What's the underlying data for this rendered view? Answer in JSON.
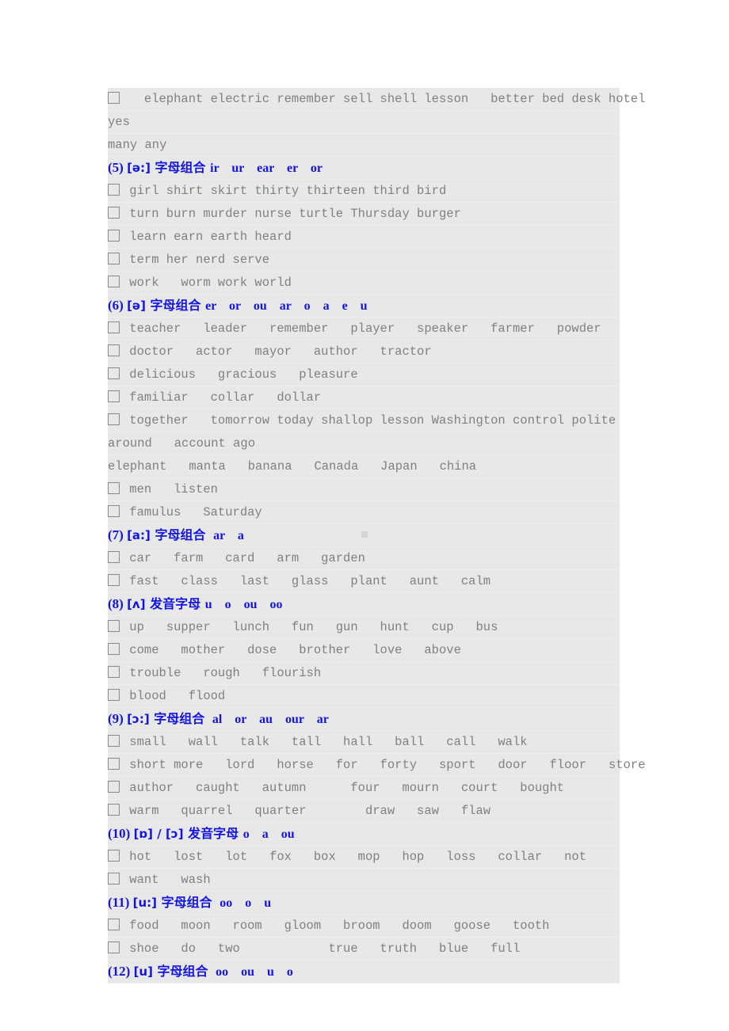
{
  "document": {
    "background_color": "#e8e8e8",
    "text_color": "#808080",
    "heading_color": "#1414e0",
    "checkbox_icon": "empty-checkbox"
  },
  "lines": [
    {
      "id": "l1",
      "type": "words",
      "checkbox": true,
      "text": "   elephant electric remember sell shell lesson   better bed desk hotel"
    },
    {
      "id": "l2",
      "type": "cont",
      "checkbox": false,
      "text": "yes"
    },
    {
      "id": "l3",
      "type": "cont",
      "checkbox": false,
      "text": "many any"
    },
    {
      "id": "h5",
      "type": "heading",
      "num": "(5)",
      "ipa": "[ə:]",
      "hz": "字母组合",
      "combos": "ir    ur    ear    er    or"
    },
    {
      "id": "l4",
      "type": "words",
      "checkbox": true,
      "text": " girl shirt skirt thirty thirteen third bird"
    },
    {
      "id": "l5",
      "type": "words",
      "checkbox": true,
      "text": " turn burn murder nurse turtle Thursday burger"
    },
    {
      "id": "l6",
      "type": "words",
      "checkbox": true,
      "text": " learn earn earth heard"
    },
    {
      "id": "l7",
      "type": "words",
      "checkbox": true,
      "text": " term her nerd serve"
    },
    {
      "id": "l8",
      "type": "words",
      "checkbox": true,
      "text": " work   worm work world"
    },
    {
      "id": "h6",
      "type": "heading",
      "num": "(6)",
      "ipa": "[ə]",
      "hz": "字母组合",
      "combos": "er    or    ou    ar    o    a    e    u"
    },
    {
      "id": "l9",
      "type": "words",
      "checkbox": true,
      "text": " teacher   leader   remember   player   speaker   farmer   powder"
    },
    {
      "id": "l10",
      "type": "words",
      "checkbox": true,
      "text": " doctor   actor   mayor   author   tractor"
    },
    {
      "id": "l11",
      "type": "words",
      "checkbox": true,
      "text": " delicious   gracious   pleasure"
    },
    {
      "id": "l12",
      "type": "words",
      "checkbox": true,
      "text": " familiar   collar   dollar"
    },
    {
      "id": "l13",
      "type": "words",
      "checkbox": true,
      "text": " together   tomorrow today shallop lesson Washington control polite"
    },
    {
      "id": "l14",
      "type": "cont",
      "checkbox": false,
      "text": "around   account ago"
    },
    {
      "id": "l15",
      "type": "cont",
      "checkbox": false,
      "text": "elephant   manta   banana   Canada   Japan   china"
    },
    {
      "id": "l16",
      "type": "words",
      "checkbox": true,
      "text": " men   listen"
    },
    {
      "id": "l17",
      "type": "words",
      "checkbox": true,
      "text": " famulus   Saturday"
    },
    {
      "id": "h7",
      "type": "heading",
      "num": "(7)",
      "ipa": "[a:]",
      "hz": "字母组合",
      "combos": " ar    a",
      "artifact": true
    },
    {
      "id": "l18",
      "type": "words",
      "checkbox": true,
      "text": " car   farm   card   arm   garden"
    },
    {
      "id": "l19",
      "type": "words",
      "checkbox": true,
      "text": " fast   class   last   glass   plant   aunt   calm"
    },
    {
      "id": "h8",
      "type": "heading",
      "num": "(8)",
      "ipa": "[ʌ]",
      "hz": "发音字母",
      "combos": "u    o    ou    oo"
    },
    {
      "id": "l20",
      "type": "words",
      "checkbox": true,
      "text": " up   supper   lunch   fun   gun   hunt   cup   bus"
    },
    {
      "id": "l21",
      "type": "words",
      "checkbox": true,
      "text": " come   mother   dose   brother   love   above"
    },
    {
      "id": "l22",
      "type": "words",
      "checkbox": true,
      "text": " trouble   rough   flourish"
    },
    {
      "id": "l23",
      "type": "words",
      "checkbox": true,
      "text": " blood   flood"
    },
    {
      "id": "h9",
      "type": "heading",
      "num": "(9)",
      "ipa": "[ɔ:]",
      "hz": "字母组合",
      "combos": " al    or    au    our    ar"
    },
    {
      "id": "l24",
      "type": "words",
      "checkbox": true,
      "text": " small   wall   talk   tall   hall   ball   call   walk"
    },
    {
      "id": "l25",
      "type": "words",
      "checkbox": true,
      "text": " short more   lord   horse   for   forty   sport   door   floor   store"
    },
    {
      "id": "l26",
      "type": "words",
      "checkbox": true,
      "text": " author   caught   autumn      four   mourn   court   bought"
    },
    {
      "id": "l27",
      "type": "words",
      "checkbox": true,
      "text": " warm   quarrel   quarter        draw   saw   flaw"
    },
    {
      "id": "h10",
      "type": "heading",
      "num": "(10)",
      "ipa": "[ɒ] / [ɔ]",
      "hz": "发音字母",
      "combos": "o    a    ou"
    },
    {
      "id": "l28",
      "type": "words",
      "checkbox": true,
      "text": " hot   lost   lot   fox   box   mop   hop   loss   collar   not"
    },
    {
      "id": "l29",
      "type": "words",
      "checkbox": true,
      "text": " want   wash"
    },
    {
      "id": "h11",
      "type": "heading",
      "num": "(11)",
      "ipa": "[u:]",
      "hz": "字母组合",
      "combos": " oo    o    u"
    },
    {
      "id": "l30",
      "type": "words",
      "checkbox": true,
      "text": " food   moon   room   gloom   broom   doom   goose   tooth"
    },
    {
      "id": "l31",
      "type": "words",
      "checkbox": true,
      "text": " shoe   do   two            true   truth   blue   full"
    },
    {
      "id": "h12",
      "type": "heading",
      "num": "(12)",
      "ipa": "[u]",
      "hz": "字母组合",
      "combos": " oo    ou    u    o"
    }
  ]
}
